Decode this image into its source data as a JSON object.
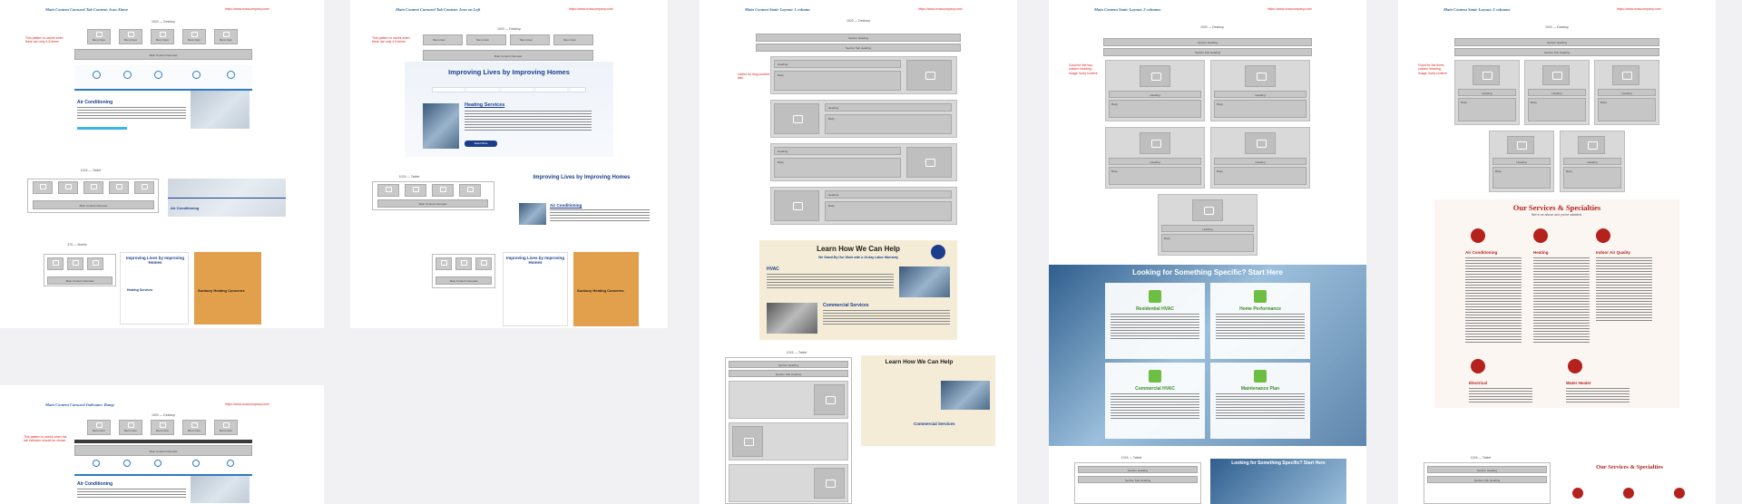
{
  "boards": [
    {
      "title": "Main Content Carousel Tab Content: Icon Above",
      "url": "https://www.hvaccompany.com/",
      "note": "This pattern is useful when there are only 4-6 items"
    },
    {
      "title": "Main Content Carousel Tab Content: Icon on Left",
      "url": "https://www.hvaccompany.com/",
      "note": "This pattern is useful when there are only 4-6 items"
    },
    {
      "title": "Main Content Static Layout: 1 column",
      "url": "https://www.hvaccompany.com/",
      "note": "Useful for long content lists"
    },
    {
      "title": "Main Content Static Layout: 2 columns",
      "url": "https://www.hvaccompany.com/",
      "note": "Good for the two-column heading, image, body content"
    },
    {
      "title": "Main Content Static Layout: 3 columns",
      "url": "https://www.hvaccompany.com/",
      "note": "Good for the three-column heading, image, body content"
    },
    {
      "title": "Main Content Carousel Indicator: Ramp",
      "url": "https://www.hvaccompany.com/",
      "note": "This pattern is useful when the tab indicator should be shown"
    }
  ],
  "labels": {
    "desktop": "1920 — Desktop",
    "tablet": "1024 — Tablet",
    "mobile": "375 — Mobile",
    "section_heading": "Section Heading",
    "sub_heading": "Section Sub Heading",
    "heading": "Heading",
    "body": "Body",
    "main_content_carousel": "Main Content Carousel"
  },
  "tabs": [
    "Menu Item",
    "Menu Item",
    "Menu Item",
    "Menu Item",
    "Menu Item"
  ],
  "services": [
    "Air Conditioning",
    "Heating",
    "Indoor Air Quality",
    "Commercial",
    "Maintenance"
  ],
  "heroes": {
    "improving": "Improving Lives by Improving Homes",
    "heating_services": "Heating Services",
    "air_conditioning": "Air Conditioning",
    "learn": "Learn How We Can Help",
    "learn_sub": "We Stand By Our Work with a 10-day Labor Warranty",
    "hvac": "HVAC",
    "commercial": "Commercial Services",
    "looking": "Looking for Something Specific? Start Here",
    "residential": "Residential HVAC",
    "home_perf": "Home Performance",
    "commercial_hvac": "Commercial HVAC",
    "maintenance": "Maintenance Plan",
    "our_services": "Our Services & Specialties",
    "our_services_sub": "We're an above and you're satisfied.",
    "svc3": [
      "Air Conditioning",
      "Heating",
      "Indoor Air Quality",
      "Electrical",
      "Water Heater"
    ],
    "sunbury": "Sunbury Heating Concerns",
    "read_more": "Read More"
  },
  "colors": {
    "accent_blue": "#1b3d8c",
    "accent_red": "#b5221e",
    "note_red": "#e02020",
    "wire_gray": "#d9d9d9"
  }
}
